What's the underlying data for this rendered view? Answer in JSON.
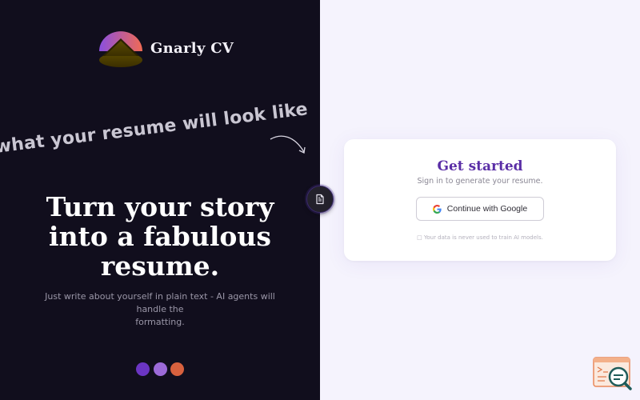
{
  "brand": {
    "name": "Gnarly CV",
    "logo_icon": "mountain-sunset-logo"
  },
  "left": {
    "preview_hint": "what your resume will look like",
    "hero_title_lines": [
      "Turn your story",
      "into a fabulous",
      "resume."
    ],
    "hero_subtitle_lines": [
      "Just write about yourself in plain text - AI agents will handle the",
      "formatting."
    ],
    "theme_dots": [
      "#6b35c3",
      "#9c6ad8",
      "#d8613e"
    ]
  },
  "toggle": {
    "icon": "document-icon"
  },
  "card": {
    "title": "Get started",
    "subtitle": "Sign in to generate your resume.",
    "google_button_label": "Continue with Google",
    "privacy_icon": "lock-icon",
    "privacy_note": "Your data is never used to train AI models."
  },
  "widget": {
    "icon": "feedback-search-icon"
  },
  "colors": {
    "left_background": "#110e1d",
    "right_background": "#f5f3fd",
    "accent": "#5a2ea6"
  }
}
